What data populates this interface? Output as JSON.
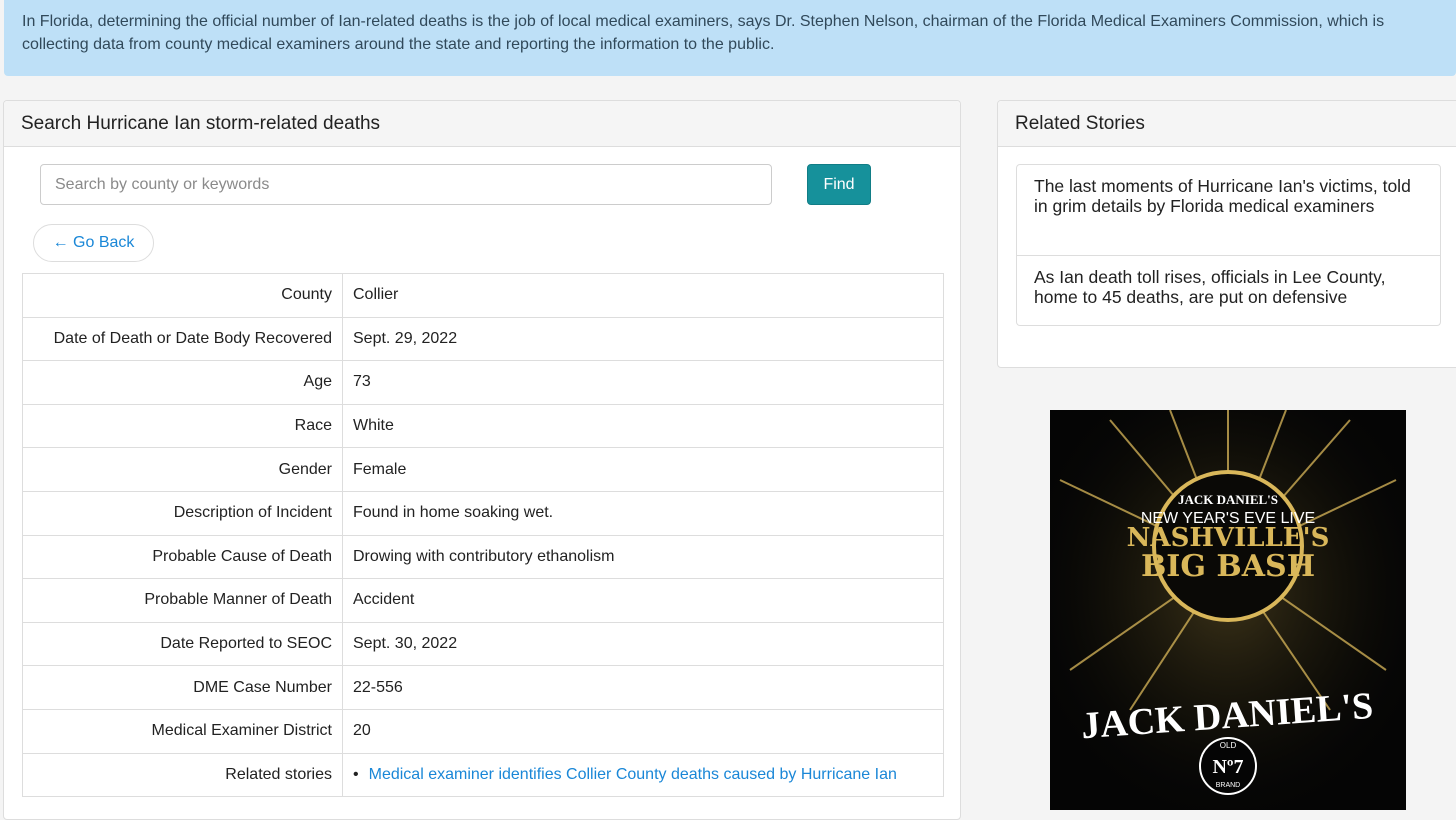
{
  "banner": {
    "text": "In Florida, determining the official number of Ian-related deaths is the job of local medical examiners, says Dr. Stephen Nelson, chairman of the Florida Medical Examiners Commission, which is collecting data from county medical examiners around the state and reporting the information to the public."
  },
  "search_panel": {
    "title": "Search Hurricane Ian storm-related deaths",
    "search_placeholder": "Search by county or keywords",
    "search_value": "",
    "find_label": "Find",
    "go_back_label": "← Go Back"
  },
  "details": {
    "rows": [
      {
        "label": "County",
        "value": "Collier"
      },
      {
        "label": "Date of Death or Date Body Recovered",
        "value": "Sept. 29, 2022"
      },
      {
        "label": "Age",
        "value": "73"
      },
      {
        "label": "Race",
        "value": "White"
      },
      {
        "label": "Gender",
        "value": "Female"
      },
      {
        "label": "Description of Incident",
        "value": "Found in home soaking wet."
      },
      {
        "label": "Probable Cause of Death",
        "value": "Drowing with contributory ethanolism"
      },
      {
        "label": "Probable Manner of Death",
        "value": "Accident"
      },
      {
        "label": "Date Reported to SEOC",
        "value": "Sept. 30, 2022"
      },
      {
        "label": "DME Case Number",
        "value": "22-556"
      },
      {
        "label": "Medical Examiner District",
        "value": "20"
      }
    ],
    "related_label": "Related stories",
    "related_link": "Medical examiner identifies Collier County deaths caused by Hurricane Ian"
  },
  "related_panel": {
    "title": "Related Stories",
    "stories": [
      "The last moments of Hurricane Ian's victims, told in grim details by Florida medical examiners",
      "As Ian death toll rises, officials in Lee County, home to 45 deaths, are put on defensive"
    ]
  },
  "ad": {
    "brand_small": "JACK DANIEL'S",
    "line1": "NEW YEAR'S EVE LIVE",
    "line2": "NASHVILLE'S",
    "line3": "BIG BASH",
    "logo": "JACK DANIEL'S",
    "badge_top": "OLD",
    "badge_mid": "Nº7",
    "badge_bottom": "BRAND",
    "colors": {
      "gold": "#d9b75a",
      "background": "#050505"
    }
  },
  "colors": {
    "banner_bg": "#bee0f7",
    "accent_teal": "#16919b",
    "link_blue": "#1a87d7"
  }
}
